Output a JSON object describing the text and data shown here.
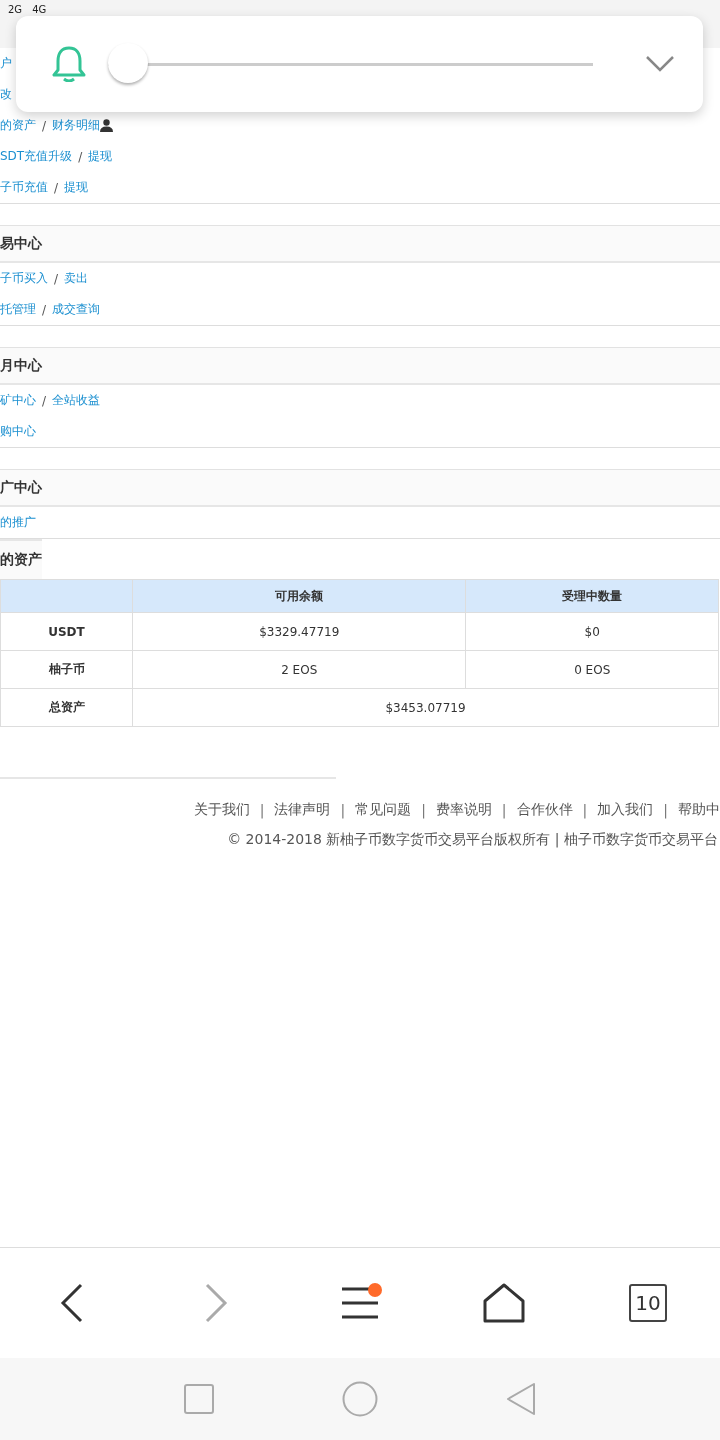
{
  "status_bar": {
    "network_1": "2G",
    "network_2": "4G"
  },
  "notification": {
    "slider": {
      "level": 0
    }
  },
  "menu_sections": [
    {
      "rows": [
        {
          "links": [
            "户"
          ]
        },
        {
          "links": [
            "改"
          ]
        },
        {
          "links": [
            "的资产",
            "财务明细"
          ],
          "user_icon": true
        },
        {
          "links": [
            "SDT充值升级",
            "提现"
          ]
        },
        {
          "links": [
            "子币充值",
            "提现"
          ]
        }
      ]
    },
    {
      "title": "易中心",
      "rows": [
        {
          "links": [
            "子币买入",
            "卖出"
          ]
        },
        {
          "links": [
            "托管理",
            "成交查询"
          ]
        }
      ]
    },
    {
      "title": "月中心",
      "rows": [
        {
          "links": [
            "矿中心",
            "全站收益"
          ]
        },
        {
          "links": [
            "购中心"
          ]
        }
      ]
    },
    {
      "title": "广中心",
      "rows": [
        {
          "links": [
            "的推广"
          ]
        }
      ]
    }
  ],
  "link_separator": "/",
  "assets": {
    "title": "的资产",
    "columns": [
      "",
      "可用余额",
      "受理中数量"
    ],
    "rows": [
      {
        "cells": [
          "USDT",
          "$3329.47719",
          "$0"
        ]
      },
      {
        "cells": [
          "柚子币",
          "2 EOS",
          "0 EOS"
        ]
      },
      {
        "cells": [
          "总资产",
          {
            "text": "$3453.07719",
            "colspan": 2
          }
        ]
      }
    ]
  },
  "footer": {
    "links": [
      "关于我们",
      "法律声明",
      "常见问题",
      "费率说明",
      "合作伙伴",
      "加入我们",
      "帮助中"
    ],
    "separator": "|",
    "copyright": "© 2014-2018 新柚子币数字货币交易平台版权所有 | 柚子币数字货币交易平台"
  },
  "browser_bar": {
    "back_enabled": true,
    "forward_enabled": false,
    "menu_badge": true,
    "tab_count": "10"
  }
}
